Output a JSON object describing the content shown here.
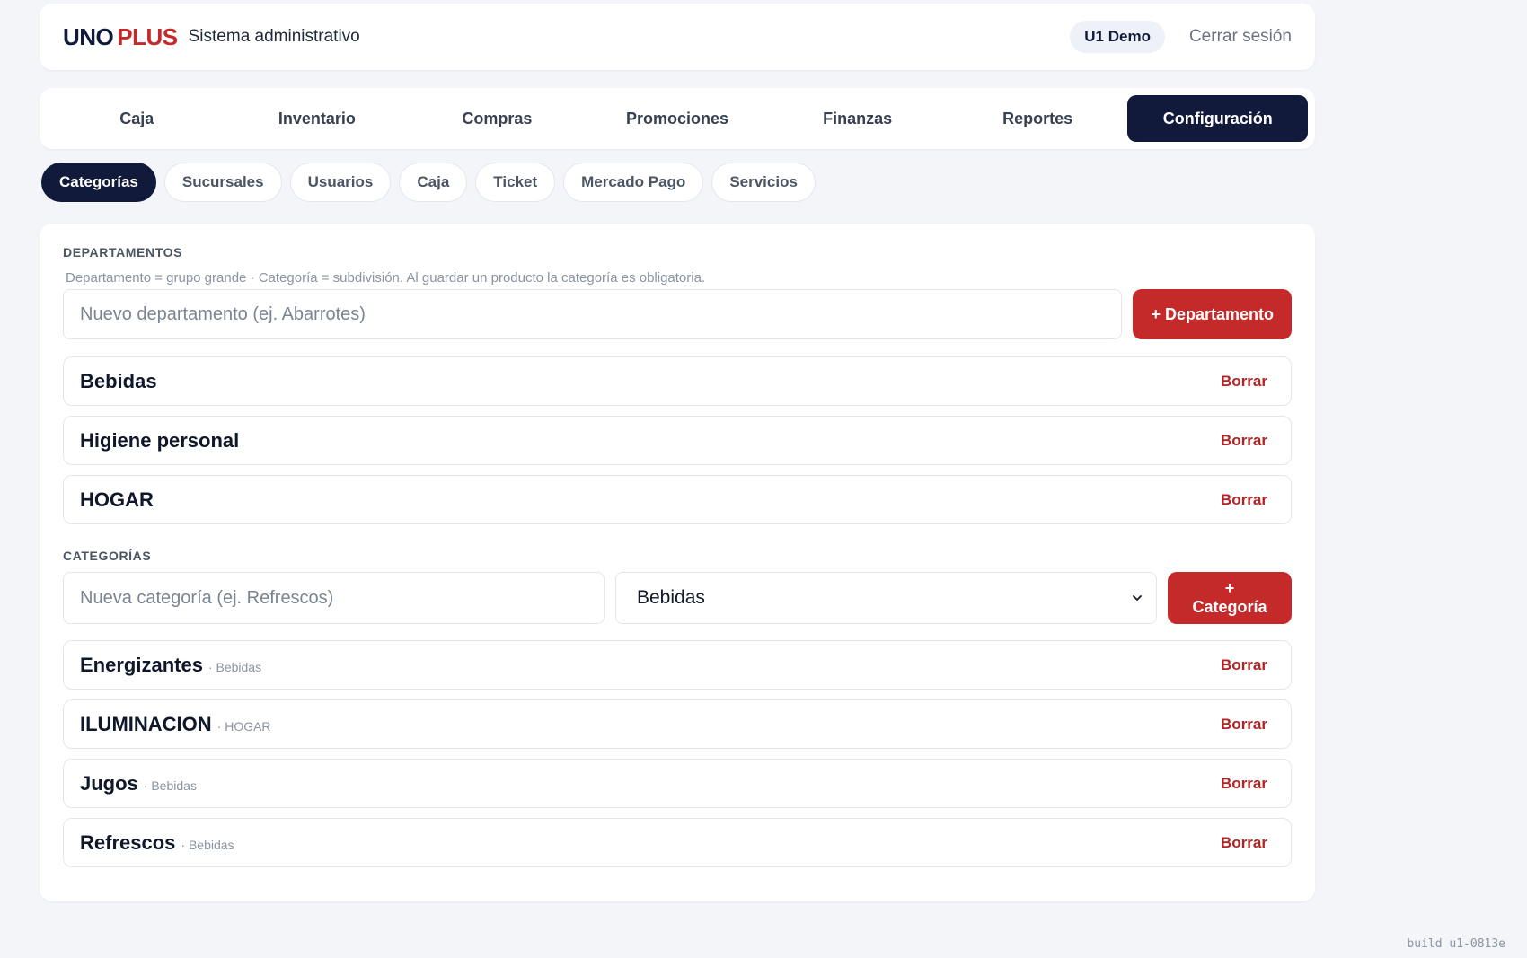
{
  "header": {
    "logo_part1": "UNO",
    "logo_part2": "PLUS",
    "subtitle": "Sistema administrativo",
    "user": "U1 Demo",
    "logout": "Cerrar sesión"
  },
  "mainnav": {
    "items": [
      {
        "label": "Caja"
      },
      {
        "label": "Inventario"
      },
      {
        "label": "Compras"
      },
      {
        "label": "Promociones"
      },
      {
        "label": "Finanzas"
      },
      {
        "label": "Reportes"
      },
      {
        "label": "Configuración"
      }
    ],
    "active": "Configuración"
  },
  "subtabs": {
    "items": [
      {
        "label": "Categorías"
      },
      {
        "label": "Sucursales"
      },
      {
        "label": "Usuarios"
      },
      {
        "label": "Caja"
      },
      {
        "label": "Ticket"
      },
      {
        "label": "Mercado Pago"
      },
      {
        "label": "Servicios"
      }
    ],
    "active": "Categorías"
  },
  "departments": {
    "title": "DEPARTAMENTOS",
    "hint": "Departamento = grupo grande · Categoría = subdivisión. Al guardar un producto la categoría es obligatoria.",
    "input_placeholder": "Nuevo departamento (ej. Abarrotes)",
    "input_value": "",
    "add_button": "+ Departamento",
    "delete_label": "Borrar",
    "items": [
      {
        "name": "Bebidas"
      },
      {
        "name": "Higiene personal"
      },
      {
        "name": "HOGAR"
      }
    ]
  },
  "categories": {
    "title": "CATEGORÍAS",
    "input_placeholder": "Nueva categoría (ej. Refrescos)",
    "input_value": "",
    "department_select": "Bebidas",
    "add_button": "+ Categoría",
    "delete_label": "Borrar",
    "items": [
      {
        "name": "Energizantes",
        "department": "· Bebidas"
      },
      {
        "name": "ILUMINACION",
        "department": "· HOGAR"
      },
      {
        "name": "Jugos",
        "department": "· Bebidas"
      },
      {
        "name": "Refrescos",
        "department": "· Bebidas"
      }
    ]
  },
  "build": "build u1-0813e",
  "colors": {
    "primary_dark": "#111a3b",
    "accent_red": "#c52a2a",
    "background": "#f3f5f9"
  },
  "icons": {
    "select_arrow": "chevron-down-icon"
  }
}
